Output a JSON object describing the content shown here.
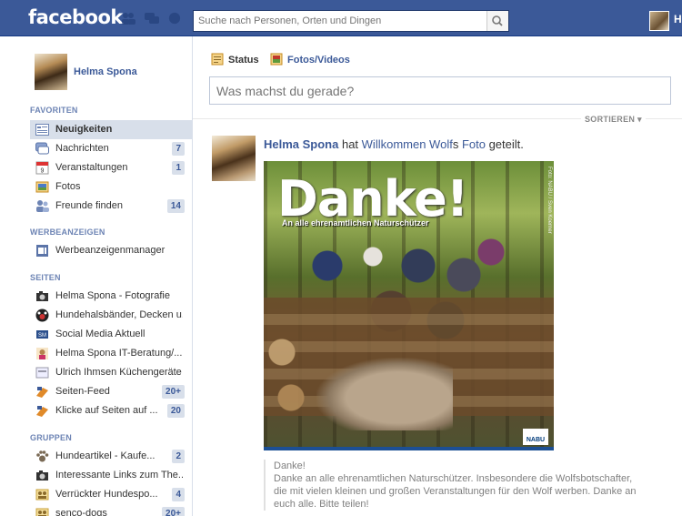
{
  "header": {
    "logo": "facebook",
    "search_placeholder": "Suche nach Personen, Orten und Dingen",
    "user_short": "H"
  },
  "sidebar": {
    "profile_name": "Helma Spona",
    "favorites_title": "FAVORITEN",
    "favorites": [
      {
        "label": "Neuigkeiten",
        "count": "",
        "icon": "news-feed-icon"
      },
      {
        "label": "Nachrichten",
        "count": "7",
        "icon": "messages-icon"
      },
      {
        "label": "Veranstaltungen",
        "count": "1",
        "icon": "events-icon"
      },
      {
        "label": "Fotos",
        "count": "",
        "icon": "photos-icon"
      },
      {
        "label": "Freunde finden",
        "count": "14",
        "icon": "find-friends-icon"
      }
    ],
    "ads_title": "WERBEANZEIGEN",
    "ads": [
      {
        "label": "Werbeanzeigenmanager",
        "count": "",
        "icon": "ads-manager-icon"
      }
    ],
    "pages_title": "SEITEN",
    "pages": [
      {
        "label": "Helma Spona - Fotografie",
        "count": "",
        "icon": "camera-page-icon"
      },
      {
        "label": "Hundehalsbänder, Decken u...",
        "count": "",
        "icon": "paw-page-icon"
      },
      {
        "label": "Social Media Aktuell",
        "count": "",
        "icon": "social-media-page-icon"
      },
      {
        "label": "Helma Spona IT-Beratung/...",
        "count": "",
        "icon": "it-page-icon"
      },
      {
        "label": "Ulrich Ihmsen Küchengeräte",
        "count": "",
        "icon": "kitchen-page-icon"
      },
      {
        "label": "Seiten-Feed",
        "count": "20+",
        "icon": "pages-feed-icon"
      },
      {
        "label": "Klicke auf Seiten auf ...",
        "count": "20",
        "icon": "like-pages-icon"
      }
    ],
    "groups_title": "GRUPPEN",
    "groups": [
      {
        "label": "Hundeartikel - Kaufe...",
        "count": "2",
        "icon": "paw-group-icon"
      },
      {
        "label": "Interessante Links zum The...",
        "count": "",
        "icon": "camera-group-icon"
      },
      {
        "label": "Verrückter Hundespo...",
        "count": "4",
        "icon": "group-icon"
      },
      {
        "label": "senco-dogs",
        "count": "20+",
        "icon": "group-icon"
      }
    ]
  },
  "composer": {
    "tab_status": "Status",
    "tab_photos": "Fotos/Videos",
    "placeholder": "Was machst du gerade?"
  },
  "feed": {
    "sort_label": "SORTIEREN ▾",
    "story": {
      "author": "Helma Spona",
      "verb": " hat ",
      "source": "Willkommen Wolf",
      "possessive": "s ",
      "object": "Foto",
      "suffix": " geteilt.",
      "photo_title": "Danke!",
      "photo_subtitle": "An alle ehrenamtlichen Naturschützer",
      "photo_credit": "Foto: NABU / Sven Koerner",
      "photo_brand": "NABU",
      "caption_line1": "Danke!",
      "caption_line2": "Danke an alle ehrenamtlichen Naturschützer. Insbesondere die Wolfsbotschafter, die mit vielen kleinen und großen Veranstaltungen für den Wolf werben. Danke an euch alle. Bitte teilen!"
    }
  }
}
